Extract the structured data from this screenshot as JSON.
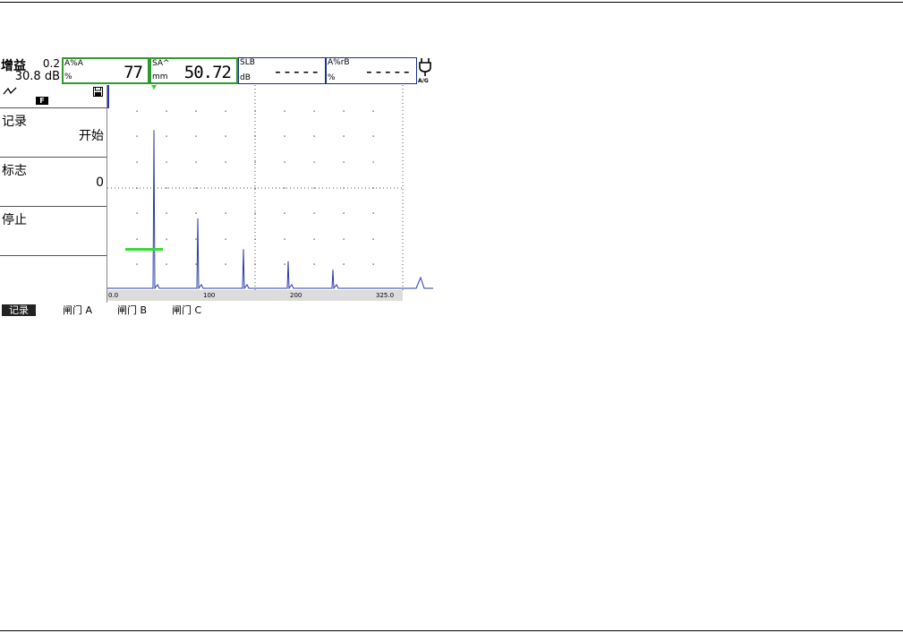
{
  "gain": {
    "label": "增益",
    "step": "0.2",
    "value": "30.8 dB"
  },
  "readouts": [
    {
      "name": "A%A",
      "unit": "%",
      "value": "77",
      "highlight": true
    },
    {
      "name": "SA^",
      "unit": "mm",
      "value": "50.72",
      "highlight": true
    },
    {
      "name": "SLB",
      "unit": "dB",
      "value": "-----",
      "highlight": false
    },
    {
      "name": "A%rB",
      "unit": "%",
      "value": "-----",
      "highlight": false
    }
  ],
  "power": {
    "icon": "plug-icon",
    "label": "A/G"
  },
  "status": {
    "icons": [
      "rectify-icon",
      "save-icon"
    ],
    "badge": "F"
  },
  "menu": [
    {
      "title": "记录",
      "value": "开始"
    },
    {
      "title": "标志",
      "value": "0"
    },
    {
      "title": "停止",
      "value": ""
    }
  ],
  "ascan": {
    "ticks": [
      "0.0",
      "100",
      "200",
      "325.0"
    ],
    "echo_heights_pct": [
      0.78,
      0.35,
      0.2,
      0.14,
      0.1
    ],
    "gate_a_level_pct": 0.2,
    "gate_color": "#33dd33",
    "trace_color": "#2a3aa8"
  },
  "softkeys": [
    {
      "label": "记录",
      "active": true
    },
    {
      "label": "闸门 A",
      "active": false
    },
    {
      "label": "闸门 B",
      "active": false
    },
    {
      "label": "闸门 C",
      "active": false
    }
  ]
}
